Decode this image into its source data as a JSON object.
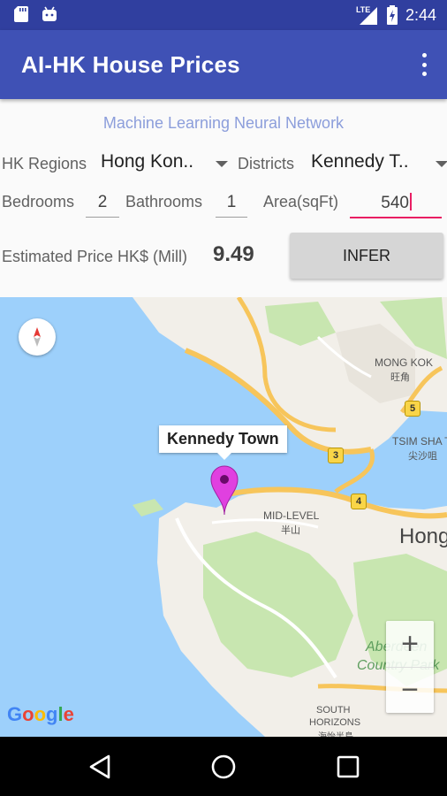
{
  "status_bar": {
    "time": "2:44",
    "network": "LTE",
    "icons": [
      "sd-card-icon",
      "android-icon",
      "lte-signal-icon",
      "battery-icon"
    ]
  },
  "app_bar": {
    "title": "AI-HK House Prices",
    "menu_icon": "overflow-menu-icon"
  },
  "form": {
    "subtitle": "Machine Learning Neural Network",
    "region_label": "HK Regions",
    "region_value": "Hong Kon..",
    "district_label": "Districts",
    "district_value": "Kennedy T..",
    "bedrooms_label": "Bedrooms",
    "bedrooms_value": "2",
    "bathrooms_label": "Bathrooms",
    "bathrooms_value": "1",
    "area_label": "Area(sqFt)",
    "area_value": "540",
    "price_label": "Estimated Price HK$ (Mill)",
    "price_value": "9.49",
    "infer_label": "INFER"
  },
  "map": {
    "marker_label": "Kennedy Town",
    "places": {
      "mong_kok": "MONG KOK",
      "mong_kok_cn": "旺角",
      "tsim_sha_tsui": "TSIM SHA TS",
      "tsim_sha_tsui_cn": "尖沙咀",
      "mid_levels": "MID-LEVEL",
      "mid_levels_cn": "半山",
      "hong_kong": "Hong",
      "aberdeen": "Aberdeen",
      "country_park": "Country Park",
      "south_horizons": "SOUTH",
      "south_horizons_2": "HORIZONS",
      "south_horizons_cn": "海怡半島"
    },
    "route_shields": [
      "5",
      "3",
      "4"
    ],
    "zoom_in": "+",
    "zoom_out": "−",
    "attribution": "Google",
    "colors": {
      "water": "#9dd0fb",
      "land": "#f2efe9",
      "park": "#c8e6b0",
      "highway": "#f7c55b",
      "marker": "#e040e0"
    }
  },
  "nav_bar": {
    "buttons": [
      "back-icon",
      "home-icon",
      "recents-icon"
    ]
  }
}
